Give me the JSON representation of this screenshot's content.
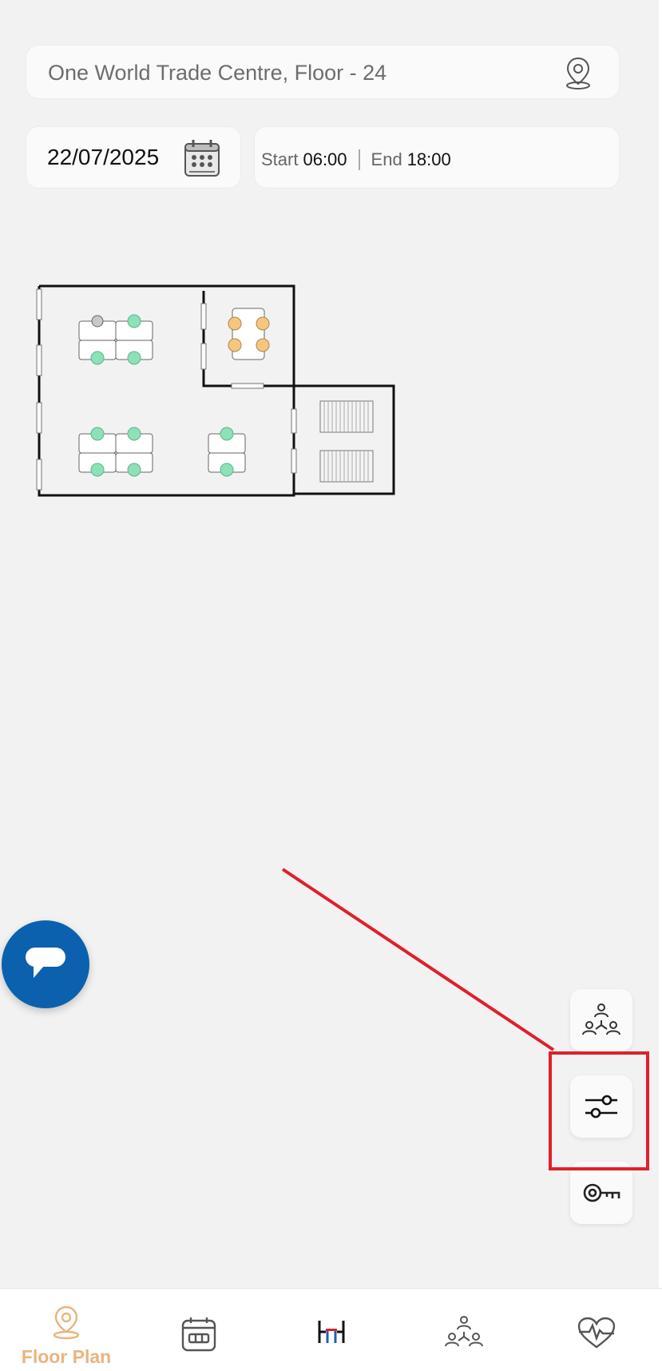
{
  "location": {
    "text": "One World Trade Centre, Floor - 24",
    "icon": "location-pin-icon"
  },
  "date": {
    "value": "22/07/2025",
    "icon": "calendar-icon"
  },
  "time": {
    "start_label": "Start",
    "start_value": "06:00",
    "end_label": "End",
    "end_value": "18:00"
  },
  "floor_plan": {
    "desk_available_color": "#8ee0b8",
    "desk_unavailable_color": "#c8c8c8",
    "meeting_room_color": "#f5c77e"
  },
  "side_buttons": [
    {
      "icon": "team-hierarchy-icon"
    },
    {
      "icon": "filter-sliders-icon"
    },
    {
      "icon": "key-icon"
    }
  ],
  "chat": {
    "icon": "chat-bubble-icon"
  },
  "nav": {
    "floor_plan_label": "Floor Plan",
    "active_color": "#e9b57e",
    "items": [
      "location-pin-icon",
      "calendar-icon",
      "desk-icon",
      "team-hierarchy-icon",
      "heart-pulse-icon"
    ]
  },
  "annotation_color": "#e0202a"
}
